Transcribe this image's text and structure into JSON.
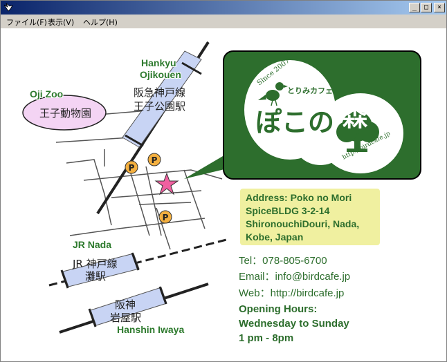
{
  "window": {
    "minimize": "_",
    "maximize": "□",
    "close": "×"
  },
  "menu": [
    {
      "label": "ファイル(F)"
    },
    {
      "label": "表示(V)"
    },
    {
      "label": "ヘルプ(H)"
    }
  ],
  "map": {
    "hankyu_en_1": "Hankyu",
    "hankyu_en_2": "Ojikouen",
    "hankyu_jp_1": "阪急神戸線",
    "hankyu_jp_2": "王子公園駅",
    "zoo_en": "Oji Zoo",
    "zoo_jp": "王子動物園",
    "jr_en": "JR Nada",
    "jr_jp_1": "JR 神戸線",
    "jr_jp_2": "灘駅",
    "hanshin_jp_1": "阪神",
    "hanshin_jp_2": "岩屋駅",
    "hanshin_en": "Hanshin Iwaya",
    "parking": "P"
  },
  "logo": {
    "since": "Since 2007",
    "subtitle": "とりみカフェ",
    "name_1": "ぽこの",
    "name_2": "森",
    "url": "http://birdcafe.jp"
  },
  "address": {
    "line1": "Address: Poko no Mori",
    "line2": "SpiceBLDG 3-2-14",
    "line3": "ShironouchiDouri, Nada,",
    "line4": "Kobe, Japan"
  },
  "contact": {
    "tel": "Tel：078-805-6700",
    "email": "Email：info@birdcafe.jp",
    "web": "Web：http://birdcafe.jp"
  },
  "hours": {
    "line1": "Opening Hours:",
    "line2": "Wednesday to Sunday",
    "line3": "1 pm - 8pm"
  },
  "colors": {
    "green": "#2d6e2d",
    "address_bg": "#f0f0a0",
    "zoo_pink": "#f4d4f4",
    "station_blue": "#c8d4f4",
    "star": "#f060a0",
    "parking": "#f4b040"
  }
}
